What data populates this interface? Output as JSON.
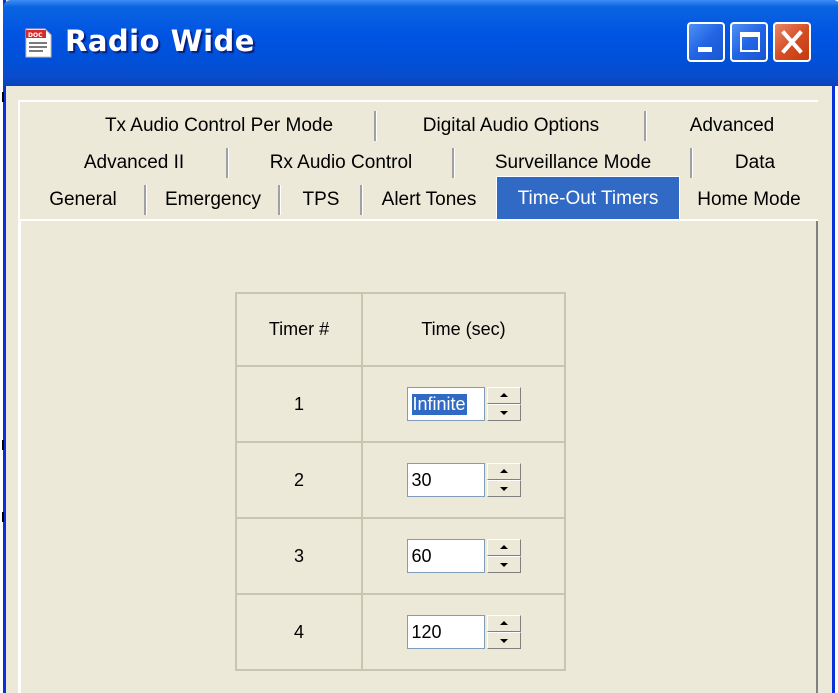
{
  "window": {
    "title": "Radio Wide",
    "icon": "doc-app-icon",
    "controls": [
      "minimize-icon",
      "maximize-icon",
      "close-icon"
    ],
    "colors": {
      "titlebar": "#0054e3",
      "close": "#d44b21",
      "face": "#ece9d8",
      "selection": "#316ac5"
    }
  },
  "tabs": {
    "row1": [
      "Tx Audio Control Per Mode",
      "Digital Audio Options",
      "Advanced"
    ],
    "row2": [
      "Advanced II",
      "Rx Audio Control",
      "Surveillance Mode",
      "Data"
    ],
    "row3": [
      "General",
      "Emergency",
      "TPS",
      "Alert Tones",
      "Time-Out Timers",
      "Home Mode"
    ],
    "active": "Time-Out Timers"
  },
  "timers": {
    "col_timer": "Timer #",
    "col_time": "Time (sec)",
    "rows": [
      {
        "timer": "1",
        "value": "Infinite"
      },
      {
        "timer": "2",
        "value": "30"
      },
      {
        "timer": "3",
        "value": "60"
      },
      {
        "timer": "4",
        "value": "120"
      }
    ]
  }
}
